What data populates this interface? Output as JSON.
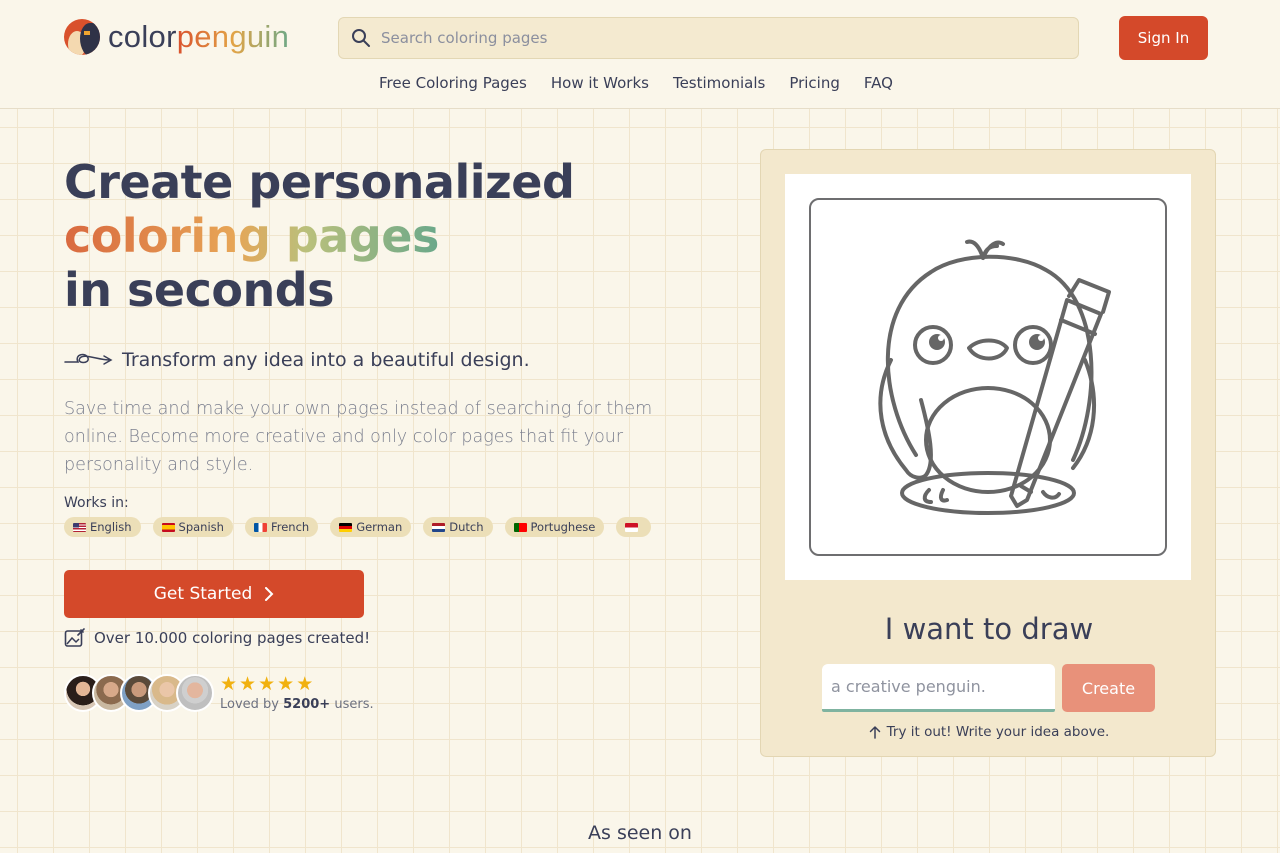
{
  "brand": {
    "name_part1": "color",
    "name_part2": "penguin"
  },
  "search": {
    "placeholder": "Search coloring pages"
  },
  "header": {
    "signin_label": "Sign In"
  },
  "nav": {
    "items": [
      "Free Coloring Pages",
      "How it Works",
      "Testimonials",
      "Pricing",
      "FAQ"
    ]
  },
  "hero": {
    "headline_line1": "Create personalized",
    "headline_line2": "coloring pages",
    "headline_line3": "in seconds",
    "tagline": "Transform any idea into a beautiful design.",
    "description": "Save time and make your own pages instead of searching for them online. Become more creative and only color pages that fit your personality and style.",
    "works_label": "Works in:",
    "languages": [
      {
        "name": "English",
        "flag": "us-flag-icon"
      },
      {
        "name": "Spanish",
        "flag": "es-flag-icon"
      },
      {
        "name": "French",
        "flag": "fr-flag-icon"
      },
      {
        "name": "German",
        "flag": "de-flag-icon"
      },
      {
        "name": "Dutch",
        "flag": "nl-flag-icon"
      },
      {
        "name": "Portughese",
        "flag": "pt-flag-icon"
      },
      {
        "name": "",
        "flag": "id-flag-icon"
      }
    ],
    "cta_label": "Get Started",
    "created_text": "Over 10.000 coloring pages created!",
    "rating_stars": 5,
    "loved_prefix": "Loved by ",
    "loved_count": "5200+",
    "loved_suffix": " users."
  },
  "demo": {
    "title": "I want to draw",
    "input_placeholder": "a creative penguin.",
    "create_label": "Create",
    "hint": "Try it out! Write your idea above."
  },
  "seen_on": {
    "title": "As seen on"
  },
  "colors": {
    "accent": "#d4492a",
    "background": "#faf6ea",
    "text": "#3a3f58",
    "card": "#f3e8cd",
    "star": "#f1b10f"
  }
}
